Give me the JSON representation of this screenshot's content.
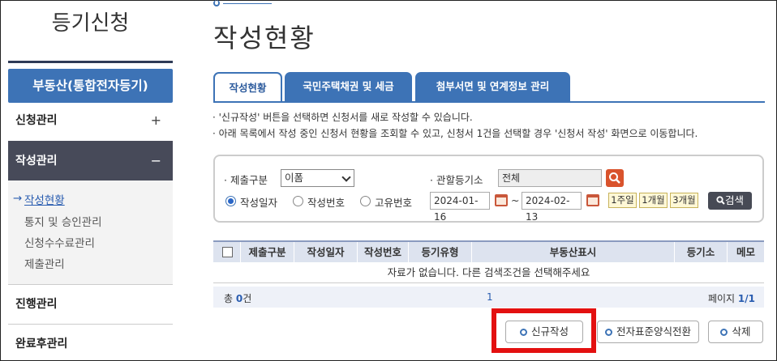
{
  "sidebar": {
    "title": "등기신청",
    "section": "부동산(통합전자등기)",
    "items": [
      {
        "label": "신청관리",
        "sign": "+"
      },
      {
        "label": "작성관리",
        "sign": "−"
      },
      {
        "label": "진행관리"
      },
      {
        "label": "완료후관리"
      }
    ],
    "subitems": [
      "작성현황",
      "통지 및 승인관리",
      "신청수수료관리",
      "제출관리"
    ],
    "current_marker": "→"
  },
  "page_title": "작성현황",
  "tabs": [
    "작성현황",
    "국민주택채권 및 세금",
    "첨부서면 및 연계정보 관리"
  ],
  "notices": [
    "· '신규작성' 버튼을 선택하면 신청서를 새로 작성할 수 있습니다.",
    "· 아래 목록에서 작성 중인 신청서 현황을 조회할 수 있고, 신청서 1건을 선택할 경우 '신청서 작성' 화면으로 이동합니다."
  ],
  "search": {
    "submit_type_label": "· 제출구분",
    "submit_type_value": "이폼",
    "registry_label": "· 관할등기소",
    "registry_value": "전체",
    "radios": [
      "작성일자",
      "작성번호",
      "고유번호"
    ],
    "date_from": "2024-01-16",
    "date_sep": "~",
    "date_to": "2024-02-13",
    "periods": [
      "1주일",
      "1개월",
      "3개월"
    ],
    "search_label": "검색"
  },
  "table": {
    "columns": [
      "제출구분",
      "작성일자",
      "작성번호",
      "등기유형",
      "부동산표시",
      "등기소",
      "메모"
    ],
    "empty_message": "자료가 없습니다. 다른 검색조건을 선택해주세요",
    "total_prefix": "총 ",
    "total_count": "0",
    "total_suffix": "건",
    "page_number": "1",
    "page_label": "페이지 ",
    "page_value": "1/1"
  },
  "actions": {
    "new": "신규작성",
    "convert": "전자표준양식전환",
    "delete": "삭제"
  },
  "colors": {
    "accent": "#3d73b6",
    "sidebar_active": "#474a59",
    "highlight": "#e31010"
  }
}
